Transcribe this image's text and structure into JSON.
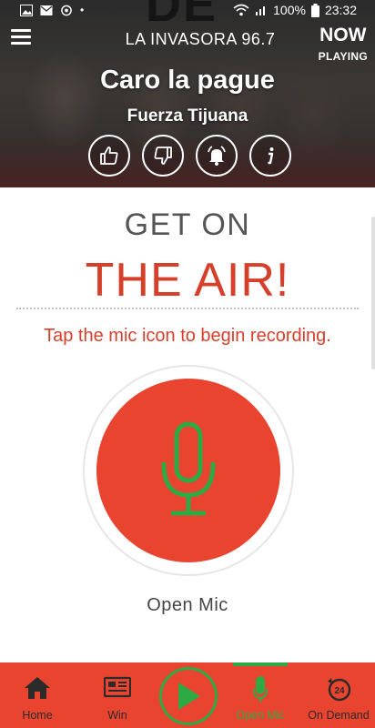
{
  "status_bar": {
    "battery": "100%",
    "time": "23:32"
  },
  "header": {
    "station_name": "LA INVASORA 96.7",
    "now_label": "NOW",
    "playing_label": "PLAYING",
    "song_title": "Caro la pague",
    "artist": "Fuerza Tijuana",
    "background_letters": "DE",
    "actions": [
      "thumbs-up-icon",
      "thumbs-down-icon",
      "alarm-bell-icon",
      "info-icon"
    ]
  },
  "main": {
    "heading_line1": "GET ON",
    "heading_line2": "THE AIR!",
    "instructions": "Tap the mic icon to begin recording.",
    "mic_label": "Open Mic"
  },
  "bottom_nav": {
    "items": [
      {
        "label": "Home",
        "icon": "home-icon"
      },
      {
        "label": "Win",
        "icon": "newspaper-icon"
      },
      {
        "label": "",
        "icon": "play-icon"
      },
      {
        "label": "Open Mic",
        "icon": "mic-icon",
        "active": true
      },
      {
        "label": "On Demand",
        "icon": "24-hour-icon"
      }
    ]
  },
  "colors": {
    "accent_red": "#e8442f",
    "heading_red": "#d6402b",
    "active_green": "#2eaa44",
    "heading_gray": "#555555"
  }
}
